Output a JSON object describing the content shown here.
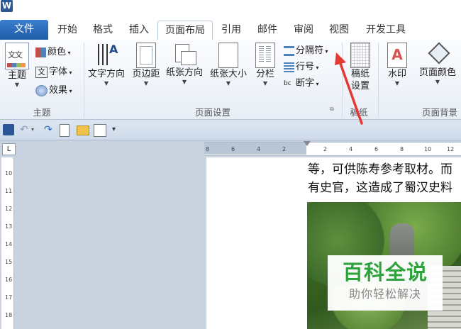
{
  "app": {
    "icon_letter": "W"
  },
  "tabs": [
    {
      "label": "文件"
    },
    {
      "label": "开始"
    },
    {
      "label": "格式"
    },
    {
      "label": "插入"
    },
    {
      "label": "页面布局",
      "active": true
    },
    {
      "label": "引用"
    },
    {
      "label": "邮件"
    },
    {
      "label": "审阅"
    },
    {
      "label": "视图"
    },
    {
      "label": "开发工具"
    }
  ],
  "ribbon": {
    "theme_group": {
      "label": "主题",
      "theme_button": "主题",
      "theme_icon_text": "文文",
      "colors": "颜色",
      "fonts": "字体",
      "effects": "效果"
    },
    "page_setup_group": {
      "label": "页面设置",
      "text_direction": "文字方向",
      "margins": "页边距",
      "orientation": "纸张方向",
      "size": "纸张大小",
      "columns": "分栏",
      "breaks": "分隔符",
      "line_numbers": "行号",
      "hyphenation": "断字"
    },
    "draft_group": {
      "label": "稿纸",
      "draft_paper": "稿纸\n设置"
    },
    "page_background_group": {
      "label": "页面背景",
      "watermark": "水印",
      "page_color": "页面颜色"
    }
  },
  "ruler": {
    "corner": "L",
    "h_numbers": [
      "8",
      "6",
      "4",
      "2",
      "2",
      "4",
      "6",
      "8",
      "10",
      "12"
    ],
    "v_numbers": [
      "10",
      "11",
      "12",
      "13",
      "14",
      "15",
      "16",
      "17",
      "18"
    ]
  },
  "document": {
    "line1": "等，可供陈寿参考取材。而",
    "line2": "有史官，这造成了蜀汉史料"
  },
  "watermark_overlay": {
    "title": "百科全说",
    "subtitle": "助你轻松解决"
  },
  "colors": {
    "file_tab": "#2b6bbd",
    "arrow": "#e53935",
    "watermark_green": "#2ea33c"
  }
}
